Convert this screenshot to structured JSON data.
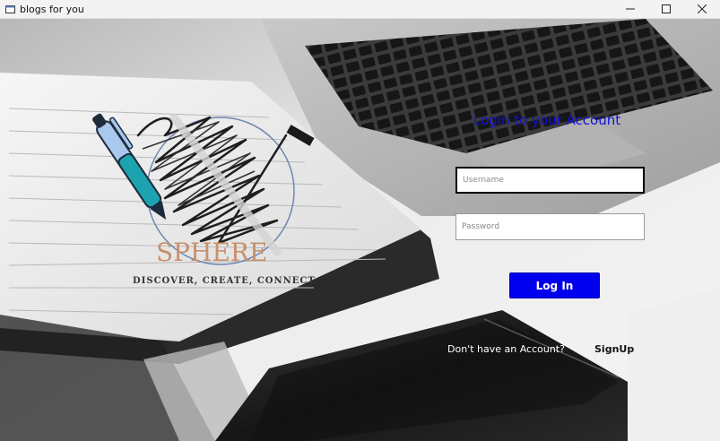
{
  "window": {
    "title": "blogs for you",
    "icons": {
      "app": "app-icon",
      "minimize": "minimize-icon",
      "maximize": "maximize-icon",
      "close": "close-icon"
    }
  },
  "logo": {
    "wordmark": "SPHERE",
    "tagline": "DISCOVER, CREATE, CONNECT"
  },
  "login": {
    "title": "Login to your Account",
    "username_placeholder": "Username",
    "username_value": "",
    "password_placeholder": "Password",
    "password_value": "",
    "login_label": "Log In",
    "no_account_text": "Don't have an Account?",
    "signup_label": "SignUp"
  },
  "colors": {
    "accent": "#0000ee",
    "title_text": "#1111dd",
    "window_chrome": "#f3f3f3"
  }
}
